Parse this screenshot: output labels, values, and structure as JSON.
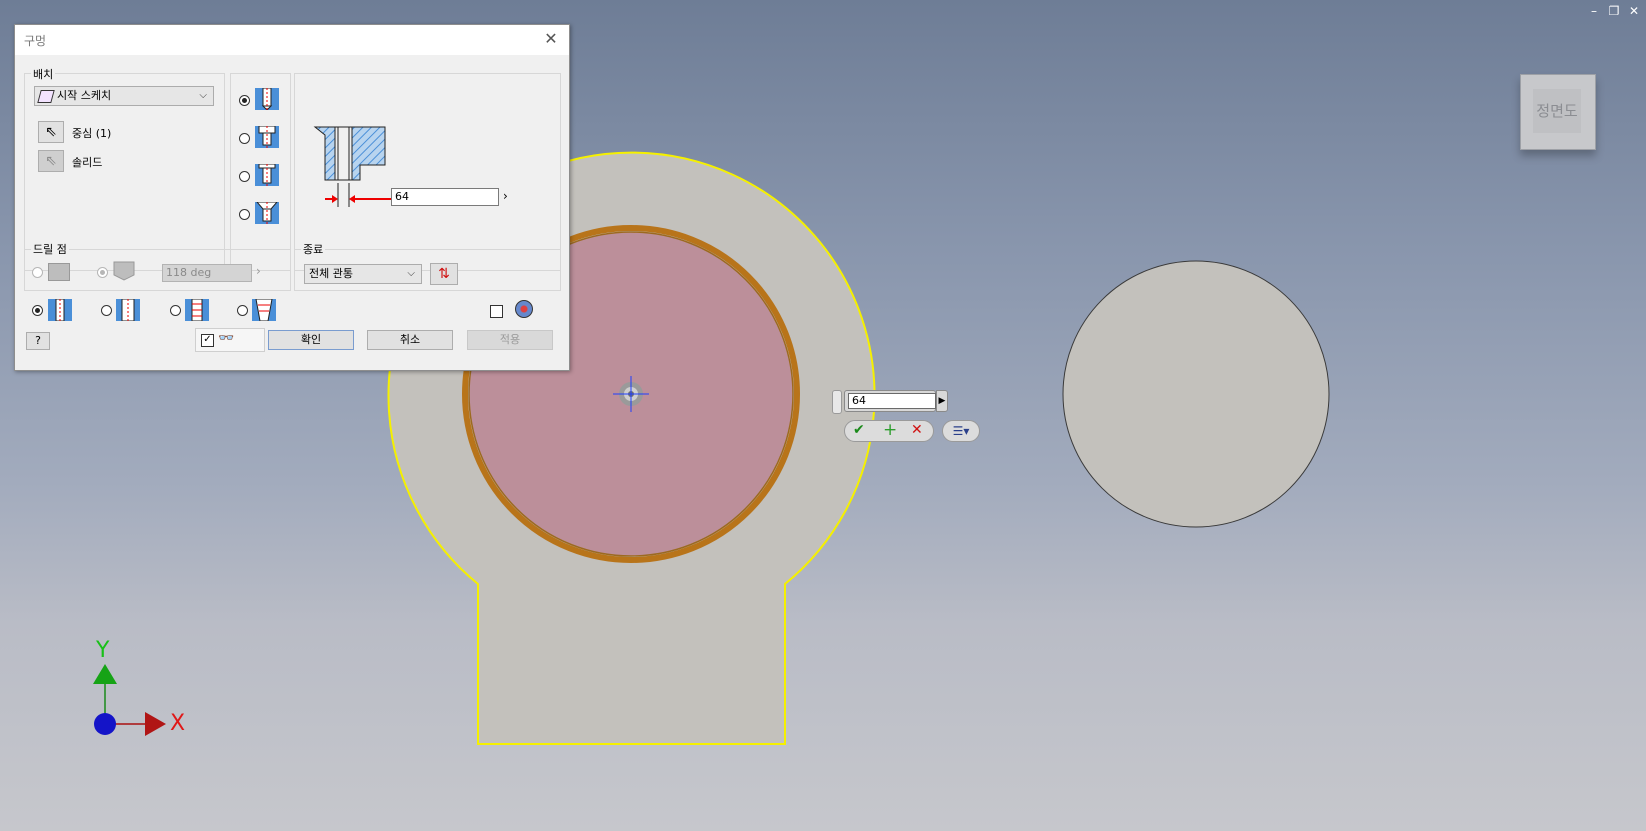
{
  "window_controls": {
    "minimize": "–",
    "restore": "❐",
    "close": "✕"
  },
  "viewcube": {
    "face_label": "정면도"
  },
  "axes": {
    "y_label": "Y",
    "x_label": "X"
  },
  "dialog": {
    "title": "구멍",
    "placement": {
      "label": "배치",
      "dropdown_value": "시작 스케치",
      "center_label": "중심 (1)",
      "solid_label": "솔리드"
    },
    "diameter_value": "64",
    "drill_point": {
      "label": "드릴 점",
      "angle": "118 deg"
    },
    "termination": {
      "label": "종료",
      "value": "전체 관통"
    },
    "buttons": {
      "ok": "확인",
      "cancel": "취소",
      "apply": "적용"
    },
    "preview_checked": true
  },
  "mini_toolbar": {
    "value": "64"
  },
  "colors": {
    "part_face": "#c3c1bc",
    "hole_fill": "#bc8f9a",
    "hole_ring": "#c97f1a",
    "outline_highlight": "#f5f000",
    "dim_arrow": "#e00000",
    "hatch": "#4a8fd8"
  }
}
